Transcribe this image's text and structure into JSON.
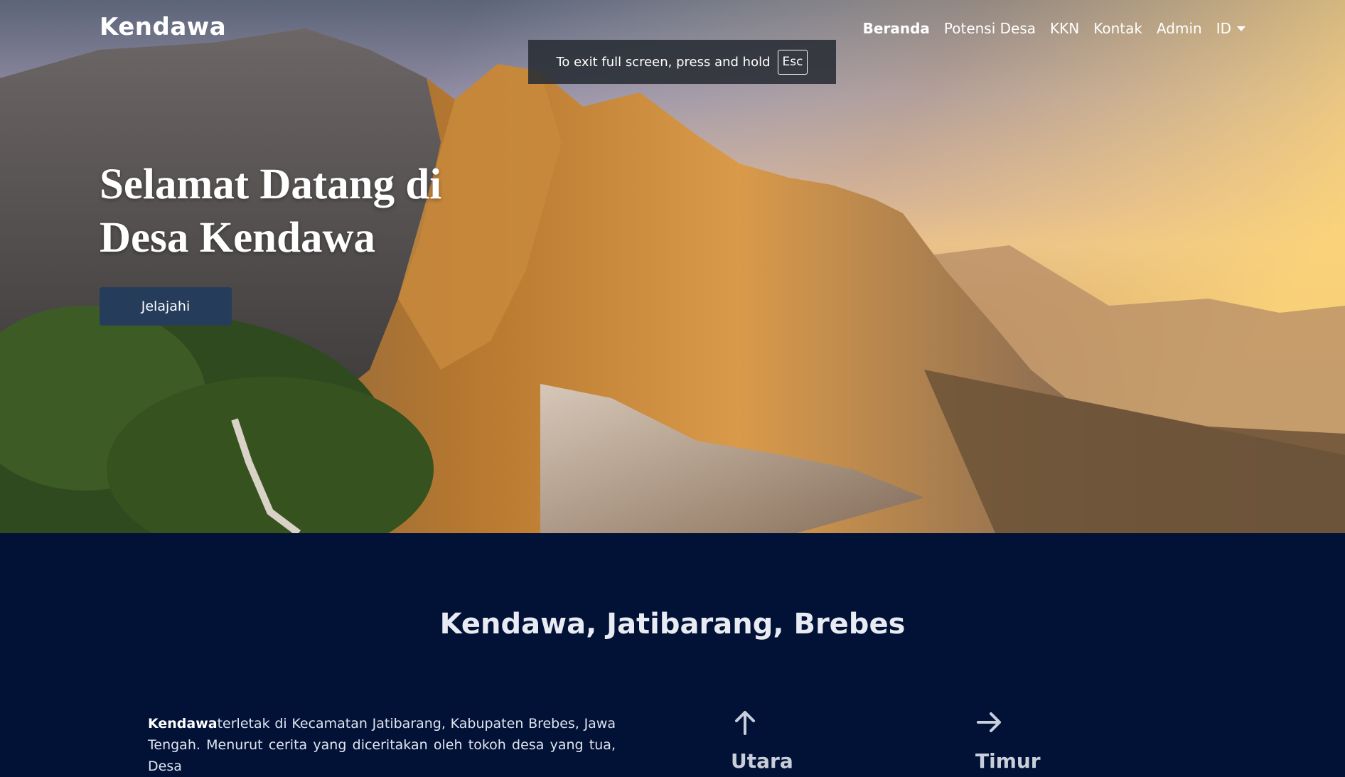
{
  "navbar": {
    "brand": "Kendawa",
    "links": [
      {
        "label": "Beranda",
        "active": true
      },
      {
        "label": "Potensi Desa",
        "active": false
      },
      {
        "label": "KKN",
        "active": false
      },
      {
        "label": "Kontak",
        "active": false
      },
      {
        "label": "Admin",
        "active": false
      }
    ],
    "language": "ID"
  },
  "fullscreen_notice": {
    "text": "To exit full screen, press and hold",
    "key": "Esc"
  },
  "hero": {
    "title": "Selamat Datang di Desa Kendawa",
    "button_label": "Jelajahi"
  },
  "location": {
    "title": "Kendawa, Jatibarang, Brebes",
    "intro_bold": "Kendawa",
    "intro_text": "terletak di Kecamatan Jatibarang, Kabupaten Brebes, Jawa Tengah. Menurut cerita yang diceritakan oleh tokoh desa yang tua, Desa"
  },
  "directions": [
    {
      "label": "Utara",
      "icon": "arrow-up-icon"
    },
    {
      "label": "Timur",
      "icon": "arrow-right-icon"
    }
  ],
  "colors": {
    "section_background": "#021237",
    "button_background": "#253d5b"
  }
}
